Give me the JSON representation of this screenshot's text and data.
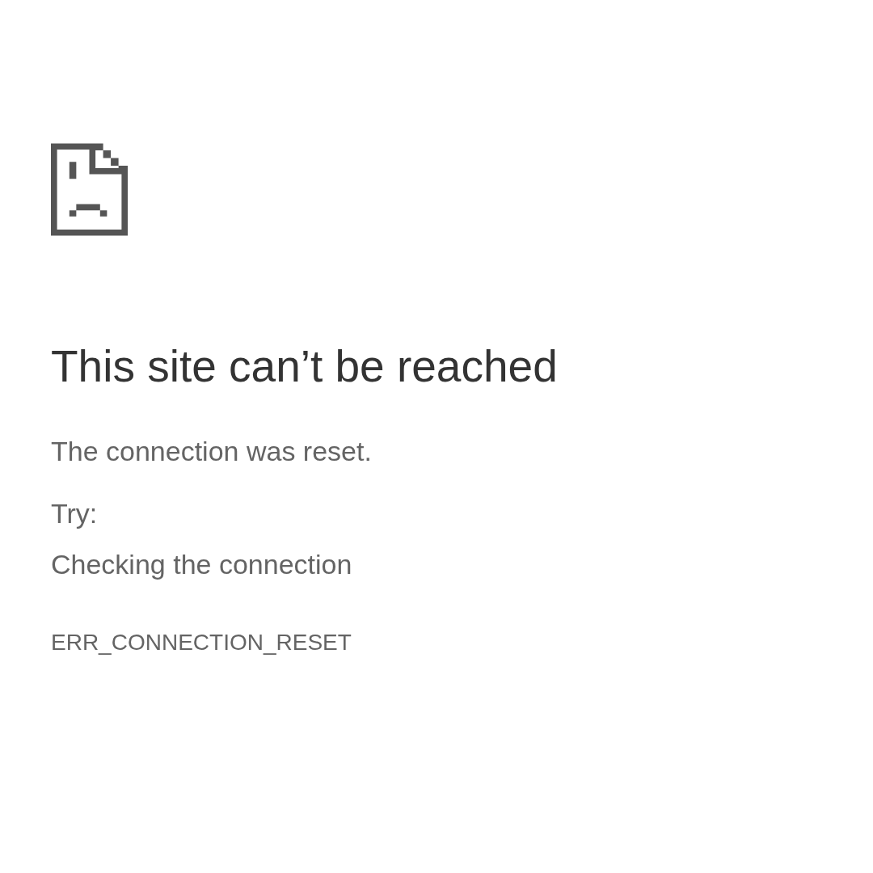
{
  "error_page": {
    "title": "This site can’t be reached",
    "message": "The connection was reset.",
    "try_label": "Try:",
    "suggestions": [
      "Checking the connection"
    ],
    "error_code": "ERR_CONNECTION_RESET"
  }
}
